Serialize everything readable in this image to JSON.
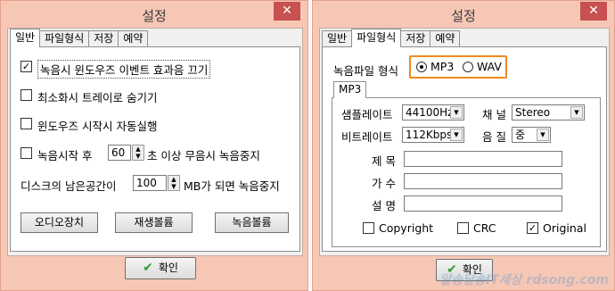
{
  "left": {
    "title": "설정",
    "close": "✕",
    "tabs": [
      "일반",
      "파일형식",
      "저장",
      "예약"
    ],
    "options": [
      {
        "label": "녹음시 윈도우즈 이벤트 효과음 끄기",
        "checked": true
      },
      {
        "label": "최소화시 트레이로 숨기기",
        "checked": false
      },
      {
        "label": "윈도우즈 시작시 자동실행",
        "checked": false
      }
    ],
    "silence": {
      "prefix": "녹음시작 후",
      "value": "60",
      "suffix": "초 이상 무음시 녹음중지",
      "checked": false
    },
    "disk": {
      "prefix": "디스크의 남은공간이",
      "value": "100",
      "suffix": "MB가 되면 녹음중지"
    },
    "buttons": [
      "오디오장치",
      "재생볼륨",
      "녹음볼륨"
    ],
    "ok": "확인",
    "check": "✔",
    "checkmark": "✓"
  },
  "right": {
    "title": "설정",
    "close": "✕",
    "tabs": [
      "일반",
      "파일형식",
      "저장",
      "예약"
    ],
    "format_label": "녹음파일 형식",
    "format_options": [
      "MP3",
      "WAV"
    ],
    "subtab": "MP3",
    "sample_rate": {
      "label": "샘플레이트",
      "value": "44100Hz"
    },
    "channel": {
      "label": "채 널",
      "value": "Stereo"
    },
    "bitrate": {
      "label": "비트레이트",
      "value": "112Kbps"
    },
    "quality": {
      "label": "음 질",
      "value": "중"
    },
    "tag_fields": [
      "제 목",
      "가 수",
      "설 명"
    ],
    "flags": [
      {
        "label": "Copyright",
        "checked": false
      },
      {
        "label": "CRC",
        "checked": false
      },
      {
        "label": "Original",
        "checked": true
      }
    ],
    "ok": "확인",
    "check": "✔",
    "checkmark": "✓",
    "watermark": "알송달송IT세상 rdsong.com"
  },
  "icons": {
    "dropdown": "▼",
    "spin_up": "▲",
    "spin_down": "▼"
  }
}
